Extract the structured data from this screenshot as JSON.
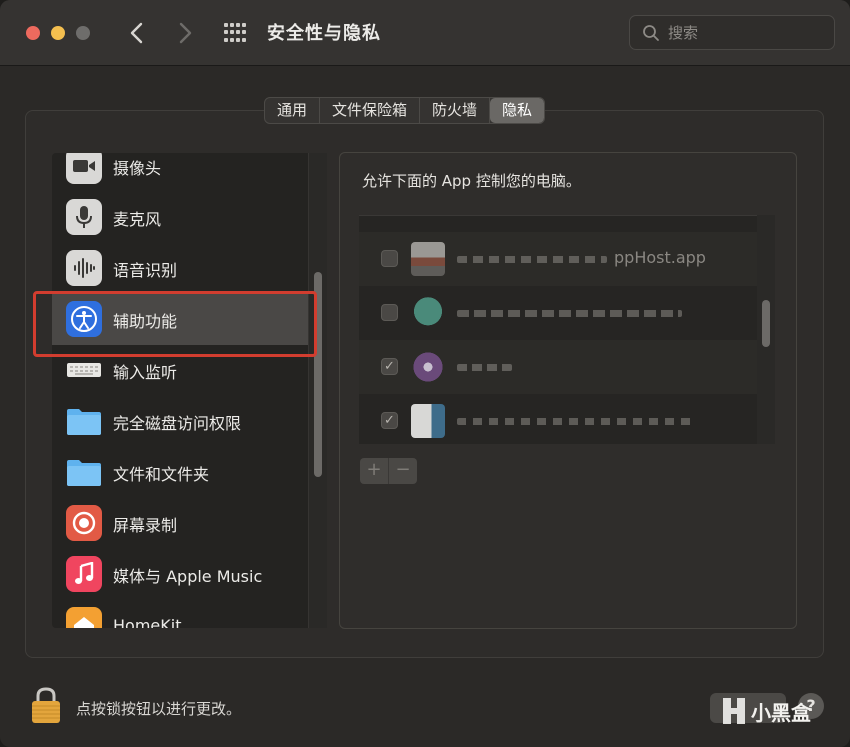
{
  "window": {
    "title": "安全性与隐私",
    "search_placeholder": "搜索"
  },
  "tabs": [
    {
      "label": "通用",
      "active": false
    },
    {
      "label": "文件保险箱",
      "active": false
    },
    {
      "label": "防火墙",
      "active": false
    },
    {
      "label": "隐私",
      "active": true
    }
  ],
  "sidebar": {
    "items": [
      {
        "label": "摄像头",
        "icon": "camera-icon"
      },
      {
        "label": "麦克风",
        "icon": "microphone-icon"
      },
      {
        "label": "语音识别",
        "icon": "speech-recognition-icon"
      },
      {
        "label": "辅助功能",
        "icon": "accessibility-icon",
        "selected": true
      },
      {
        "label": "输入监听",
        "icon": "keyboard-icon"
      },
      {
        "label": "完全磁盘访问权限",
        "icon": "folder-icon"
      },
      {
        "label": "文件和文件夹",
        "icon": "folder-icon"
      },
      {
        "label": "屏幕录制",
        "icon": "screen-recording-icon"
      },
      {
        "label": "媒体与 Apple Music",
        "icon": "music-icon"
      },
      {
        "label": "HomeKit",
        "icon": "home-icon"
      }
    ]
  },
  "detail": {
    "description": "允许下面的 App 控制您的电脑。",
    "apps": [
      {
        "name": "ppHost.app",
        "checked": true
      },
      {
        "name": "",
        "checked": true
      },
      {
        "name": "",
        "checked": true
      },
      {
        "name": "",
        "checked": true
      }
    ],
    "add_label": "+",
    "remove_label": "−"
  },
  "footer": {
    "lock_text": "点按锁按钮以进行更改。",
    "help_label": "?",
    "watermark": "小黑盒"
  },
  "colors": {
    "highlight": "#d23d2f",
    "selected_row": "#4a4846"
  }
}
